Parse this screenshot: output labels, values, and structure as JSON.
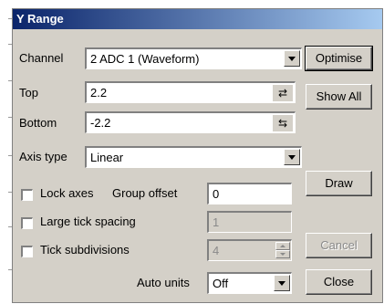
{
  "dialog": {
    "title": "Y Range"
  },
  "channel": {
    "label": "Channel",
    "value": "2 ADC 1 (Waveform)"
  },
  "top": {
    "label": "Top",
    "value": "2.2"
  },
  "bottom": {
    "label": "Bottom",
    "value": "-2.2"
  },
  "axis_type": {
    "label": "Axis type",
    "value": "Linear"
  },
  "lock_axes": {
    "label": "Lock axes",
    "checked": false
  },
  "group_offset": {
    "label": "Group offset",
    "value": "0"
  },
  "large_tick": {
    "label": "Large tick spacing",
    "value": "1",
    "checked": false
  },
  "tick_subdivisions": {
    "label": "Tick subdivisions",
    "value": "4",
    "checked": false
  },
  "auto_units": {
    "label": "Auto units",
    "value": "Off"
  },
  "buttons": {
    "optimise": "Optimise",
    "show_all": "Show All",
    "draw": "Draw",
    "cancel": "Cancel",
    "close": "Close"
  },
  "icons": {
    "swap_down": "swap-down-icon",
    "swap_up": "swap-up-icon"
  }
}
